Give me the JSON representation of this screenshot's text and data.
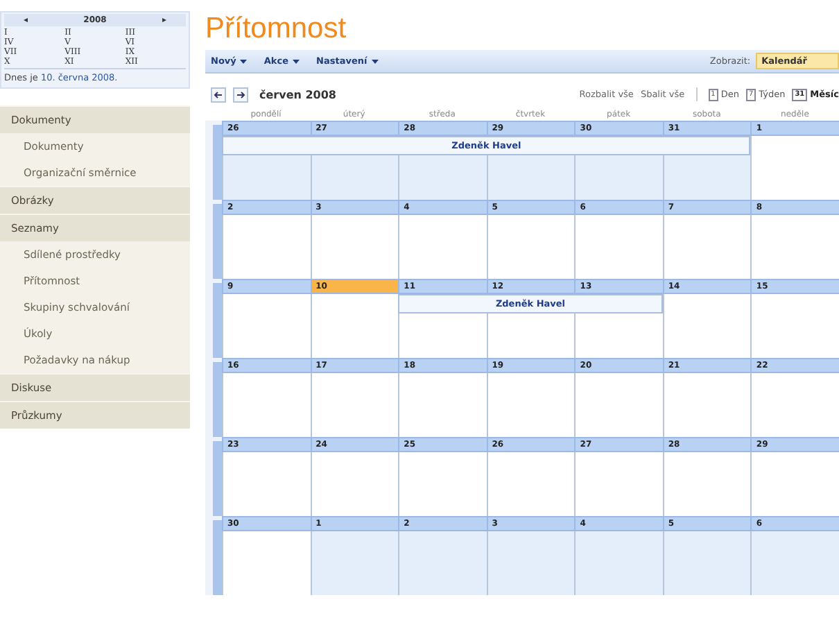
{
  "mini_calendar": {
    "prev": "◂",
    "year": "2008",
    "next": "▸",
    "months": [
      {
        "label": "I"
      },
      {
        "label": "II"
      },
      {
        "label": "III"
      },
      {
        "label": "IV"
      },
      {
        "label": "V"
      },
      {
        "label": "VI"
      },
      {
        "label": "VII"
      },
      {
        "label": "VIII"
      },
      {
        "label": "IX"
      },
      {
        "label": "X"
      },
      {
        "label": "XI"
      },
      {
        "label": "XII"
      }
    ],
    "today_text": "Dnes je ",
    "today_link": "10. června 2008."
  },
  "sidebar": {
    "items": [
      {
        "label": "Dokumenty",
        "children": [
          {
            "label": "Dokumenty"
          },
          {
            "label": "Organizační směrnice"
          }
        ]
      },
      {
        "label": "Obrázky"
      },
      {
        "label": "Seznamy",
        "children": [
          {
            "label": "Sdílené prostředky"
          },
          {
            "label": "Přítomnost"
          },
          {
            "label": "Skupiny schvalování"
          },
          {
            "label": "Úkoly"
          },
          {
            "label": "Požadavky na nákup"
          }
        ]
      },
      {
        "label": "Diskuse"
      },
      {
        "label": "Průzkumy"
      }
    ]
  },
  "page_title": "Přítomnost",
  "toolbar": {
    "menus": [
      "Nový",
      "Akce",
      "Nastavení"
    ],
    "view_label": "Zobrazit:",
    "view_value": "Kalendář"
  },
  "nav": {
    "month": "červen 2008",
    "expand": "Rozbalit vše",
    "collapse": "Sbalit vše",
    "views": [
      {
        "icon": "1",
        "label": "Den",
        "selected": false
      },
      {
        "icon": "7",
        "label": "Týden",
        "selected": false
      },
      {
        "icon": "31",
        "label": "Měsíc",
        "selected": true
      }
    ]
  },
  "weekdays": [
    "pondělí",
    "úterý",
    "středa",
    "čtvrtek",
    "pátek",
    "sobota",
    "neděle"
  ],
  "weeks": [
    {
      "days": [
        {
          "n": "26",
          "outside": true,
          "today": false
        },
        {
          "n": "27",
          "outside": true,
          "today": false
        },
        {
          "n": "28",
          "outside": true,
          "today": false
        },
        {
          "n": "29",
          "outside": true,
          "today": false
        },
        {
          "n": "30",
          "outside": true,
          "today": false
        },
        {
          "n": "31",
          "outside": true,
          "today": false
        },
        {
          "n": "1",
          "outside": false,
          "today": false
        }
      ],
      "events": [
        {
          "title": "Zdeněk Havel",
          "covers": [
            true,
            true,
            true,
            true,
            true,
            true,
            false
          ]
        }
      ]
    },
    {
      "days": [
        {
          "n": "2",
          "outside": false,
          "today": false
        },
        {
          "n": "3",
          "outside": false,
          "today": false
        },
        {
          "n": "4",
          "outside": false,
          "today": false
        },
        {
          "n": "5",
          "outside": false,
          "today": false
        },
        {
          "n": "6",
          "outside": false,
          "today": false
        },
        {
          "n": "7",
          "outside": false,
          "today": false
        },
        {
          "n": "8",
          "outside": false,
          "today": false
        }
      ]
    },
    {
      "days": [
        {
          "n": "9",
          "outside": false,
          "today": false
        },
        {
          "n": "10",
          "outside": false,
          "today": true
        },
        {
          "n": "11",
          "outside": false,
          "today": false
        },
        {
          "n": "12",
          "outside": false,
          "today": false
        },
        {
          "n": "13",
          "outside": false,
          "today": false
        },
        {
          "n": "14",
          "outside": false,
          "today": false
        },
        {
          "n": "15",
          "outside": false,
          "today": false
        }
      ],
      "events": [
        {
          "title": "Zdeněk Havel",
          "covers": [
            false,
            false,
            true,
            true,
            true,
            false,
            false
          ]
        }
      ]
    },
    {
      "days": [
        {
          "n": "16",
          "outside": false,
          "today": false
        },
        {
          "n": "17",
          "outside": false,
          "today": false
        },
        {
          "n": "18",
          "outside": false,
          "today": false
        },
        {
          "n": "19",
          "outside": false,
          "today": false
        },
        {
          "n": "20",
          "outside": false,
          "today": false
        },
        {
          "n": "21",
          "outside": false,
          "today": false
        },
        {
          "n": "22",
          "outside": false,
          "today": false
        }
      ]
    },
    {
      "days": [
        {
          "n": "23",
          "outside": false,
          "today": false
        },
        {
          "n": "24",
          "outside": false,
          "today": false
        },
        {
          "n": "25",
          "outside": false,
          "today": false
        },
        {
          "n": "26",
          "outside": false,
          "today": false
        },
        {
          "n": "27",
          "outside": false,
          "today": false
        },
        {
          "n": "28",
          "outside": false,
          "today": false
        },
        {
          "n": "29",
          "outside": false,
          "today": false
        }
      ]
    },
    {
      "days": [
        {
          "n": "30",
          "outside": false,
          "today": false
        },
        {
          "n": "1",
          "outside": true,
          "today": false
        },
        {
          "n": "2",
          "outside": true,
          "today": false
        },
        {
          "n": "3",
          "outside": true,
          "today": false
        },
        {
          "n": "4",
          "outside": true,
          "today": false
        },
        {
          "n": "5",
          "outside": true,
          "today": false
        },
        {
          "n": "6",
          "outside": true,
          "today": false
        }
      ]
    }
  ]
}
